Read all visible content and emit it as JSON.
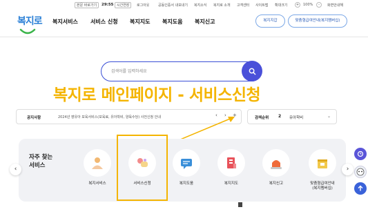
{
  "utility": {
    "home_button": "본문 바로가기",
    "time": "29:55",
    "extend_button": "시간연장",
    "logout": "로그아웃",
    "certificate": "공동인증서 내보내기",
    "news": "복지소식",
    "about": "복지로 소개",
    "center": "고객센터",
    "sitemap": "사이트맵",
    "zoom_label": "확대크기",
    "zoom_plus": "+",
    "zoom_value": "100%",
    "zoom_minus": "-",
    "accessibility": "화면안내해"
  },
  "header": {
    "logo": "복지로",
    "nav": [
      "복지서비스",
      "서비스 신청",
      "복지지도",
      "복지도움",
      "복지신고"
    ],
    "btn_welfare": "복지지갑",
    "btn_guide": "맞춤형급여안내(복지멤버십)"
  },
  "search": {
    "placeholder": "검색어를 입력하세요"
  },
  "overlay": {
    "title": "복지로 메인페이지 - 서비스신청"
  },
  "notice": {
    "label": "공지사항",
    "text": "2024년 영유아 보육서비스(보육료, 유아학비, 양육수당) 사전신청 안내",
    "prev": "‹",
    "next": "›",
    "add": "+"
  },
  "rank": {
    "label": "검색순위",
    "num": "2",
    "value": "유아학비"
  },
  "quick": {
    "title_line1": "자주 찾는",
    "title_line2": "서비스",
    "prev": "‹",
    "next": "›",
    "items": [
      {
        "label": "복지서비스",
        "icon": "person-icon"
      },
      {
        "label": "서비스신청",
        "icon": "hand-apply-icon"
      },
      {
        "label": "복지도움",
        "icon": "chat-icon"
      },
      {
        "label": "복지지도",
        "icon": "map-icon"
      },
      {
        "label": "복지신고",
        "icon": "siren-icon"
      },
      {
        "label": "맞춤형급여안내",
        "label2": "(복지멤버십)",
        "icon": "gift-icon"
      }
    ]
  },
  "colors": {
    "brand_blue": "#2a7fd6",
    "search_blue": "#4a50d9",
    "highlight": "#f4b400"
  }
}
